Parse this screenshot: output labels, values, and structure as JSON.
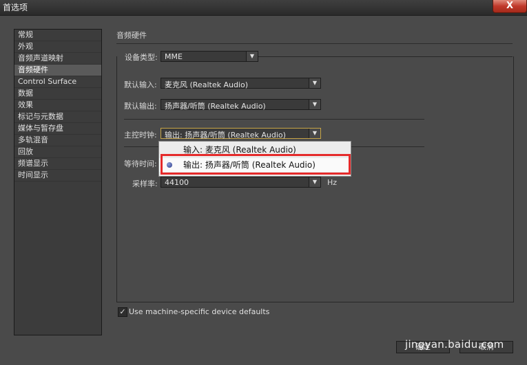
{
  "window": {
    "title": "首选项",
    "close_label": "X"
  },
  "sidebar": {
    "items": [
      {
        "label": "常规"
      },
      {
        "label": "外观"
      },
      {
        "label": "音频声道映射"
      },
      {
        "label": "音频硬件",
        "selected": true
      },
      {
        "label": "Control Surface"
      },
      {
        "label": "数据"
      },
      {
        "label": "效果"
      },
      {
        "label": "标记与元数据"
      },
      {
        "label": "媒体与暂存盘"
      },
      {
        "label": "多轨混音"
      },
      {
        "label": "回放"
      },
      {
        "label": "频谱显示"
      },
      {
        "label": "时间显示"
      }
    ]
  },
  "section": {
    "title": "音频硬件"
  },
  "fields": {
    "device_type": {
      "label": "设备类型:",
      "value": "MME"
    },
    "default_input": {
      "label": "默认输入:",
      "value": "麦克风 (Realtek Audio)"
    },
    "default_output": {
      "label": "默认输出:",
      "value": "扬声器/听筒 (Realtek Audio)"
    },
    "master_clock": {
      "label": "主控时钟:",
      "value": "输出: 扬声器/听筒 (Realtek Audio)"
    },
    "latency": {
      "label": "等待时间:"
    },
    "sample_rate": {
      "label": "采样率:",
      "value": "44100",
      "unit": "Hz"
    }
  },
  "clock_menu": {
    "options": [
      {
        "label": "输入: 麦克风 (Realtek Audio)",
        "selected": false
      },
      {
        "label": "输出: 扬声器/听筒 (Realtek Audio)",
        "selected": true
      }
    ]
  },
  "checkbox": {
    "label": "Use machine-specific device defaults",
    "checked": true
  },
  "buttons": {
    "ok": "确定",
    "cancel": "取消"
  },
  "watermark": "jingyan.baidu.com",
  "colors": {
    "highlight": "#e52a2a",
    "focus_border": "#c7a547"
  }
}
